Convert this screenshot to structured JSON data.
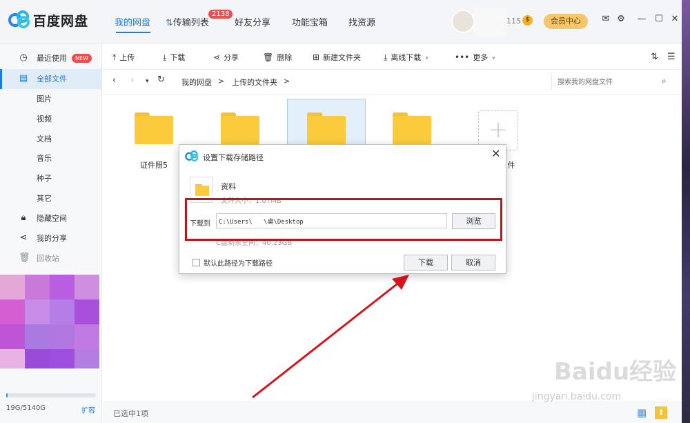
{
  "app": {
    "brand": "百度网盘"
  },
  "nav": {
    "my_disk": "我的网盘",
    "transfer": "传输列表",
    "transfer_badge": "2138",
    "share": "好友分享",
    "tools": "功能宝箱",
    "find": "找资源"
  },
  "user": {
    "number": "115",
    "coin_symbol": "$",
    "vip": "会员中心"
  },
  "sidebar": {
    "items": [
      {
        "label": "最近使用",
        "icon": "clock-icon",
        "badge": "NEW"
      },
      {
        "label": "全部文件",
        "icon": "document-icon"
      },
      {
        "label": "图片"
      },
      {
        "label": "视频"
      },
      {
        "label": "文档"
      },
      {
        "label": "音乐"
      },
      {
        "label": "种子"
      },
      {
        "label": "其它"
      },
      {
        "label": "隐藏空间",
        "icon": "lock-icon"
      },
      {
        "label": "我的分享",
        "icon": "share-icon"
      },
      {
        "label": "回收站",
        "icon": "trash-icon"
      }
    ],
    "quota": "19G/5140G",
    "quota_ratio": 0.0037,
    "expand": "扩容"
  },
  "toolbar": {
    "upload": "上传",
    "download": "下载",
    "share": "分享",
    "delete": "删除",
    "new_folder": "新建文件夹",
    "offline": "离线下载",
    "more": "更多"
  },
  "path": {
    "root": "我的网盘",
    "sep": ">",
    "current": "上传的文件夹",
    "search_placeholder": "搜索我的网盘文件"
  },
  "files": [
    {
      "name": "证件照5"
    },
    {
      "name": ""
    },
    {
      "name": ""
    },
    {
      "name": ""
    },
    {
      "name": "件"
    }
  ],
  "status": {
    "selected": "已选中1项"
  },
  "dialog": {
    "title": "设置下载存储路径",
    "file_name": "资料",
    "file_size": "文件大小：1.07MB",
    "path_label": "下载到",
    "path_value": "C:\\Users\\   \\桌\\Desktop",
    "browse": "浏览",
    "space": "C盘剩余空间：40.23GB",
    "default_label": "默认此路径为下载路径",
    "download": "下载",
    "cancel": "取消"
  },
  "watermark": {
    "text": "Baidu经验",
    "url": "jingyan.baidu.com"
  },
  "colors": {
    "accent": "#1e7ae6",
    "badge": "#f04c4c",
    "folder": "#fbcb3c",
    "highlight_frame": "#c0141c"
  }
}
